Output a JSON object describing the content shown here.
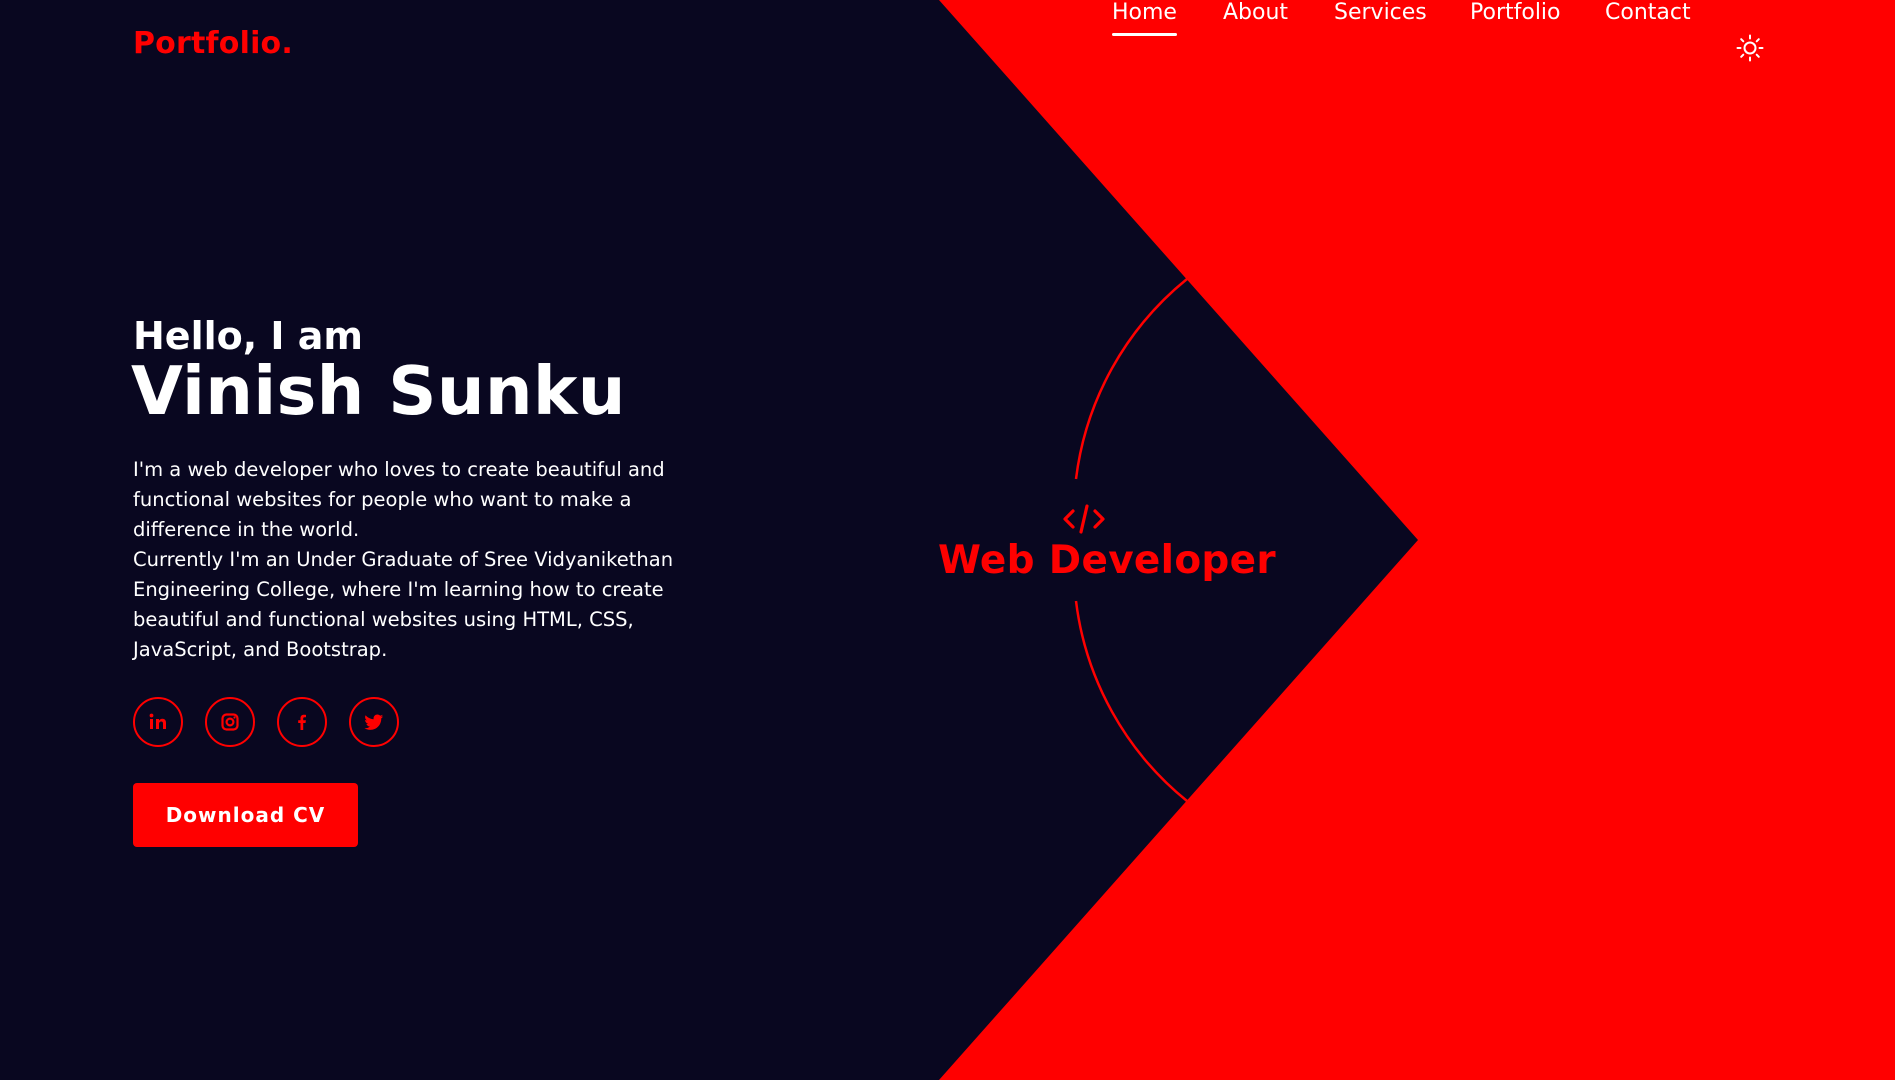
{
  "brand": {
    "logo": "Portfolio.",
    "accent_color": "#ff0000",
    "background_color": "#090720"
  },
  "nav": {
    "items": [
      {
        "label": "Home",
        "active": true
      },
      {
        "label": "About",
        "active": false
      },
      {
        "label": "Services",
        "active": false
      },
      {
        "label": "Portfolio",
        "active": false
      },
      {
        "label": "Contact",
        "active": false
      }
    ],
    "theme_toggle_icon": "sun-icon"
  },
  "hero": {
    "greeting": "Hello, I am",
    "name": "Vinish Sunku",
    "description_1": "I'm a web developer who loves to create beautiful and functional websites for people who want to make a difference in the world.",
    "description_2": "Currently I'm an Under Graduate of Sree Vidyanikethan Engineering College, where I'm learning how to create beautiful and functional websites using HTML, CSS, JavaScript, and Bootstrap.",
    "socials": [
      {
        "icon": "linkedin-icon"
      },
      {
        "icon": "instagram-icon"
      },
      {
        "icon": "facebook-icon"
      },
      {
        "icon": "twitter-icon"
      }
    ],
    "cta_label": "Download CV"
  },
  "role": {
    "icon": "code-icon",
    "title": "Web Developer"
  }
}
